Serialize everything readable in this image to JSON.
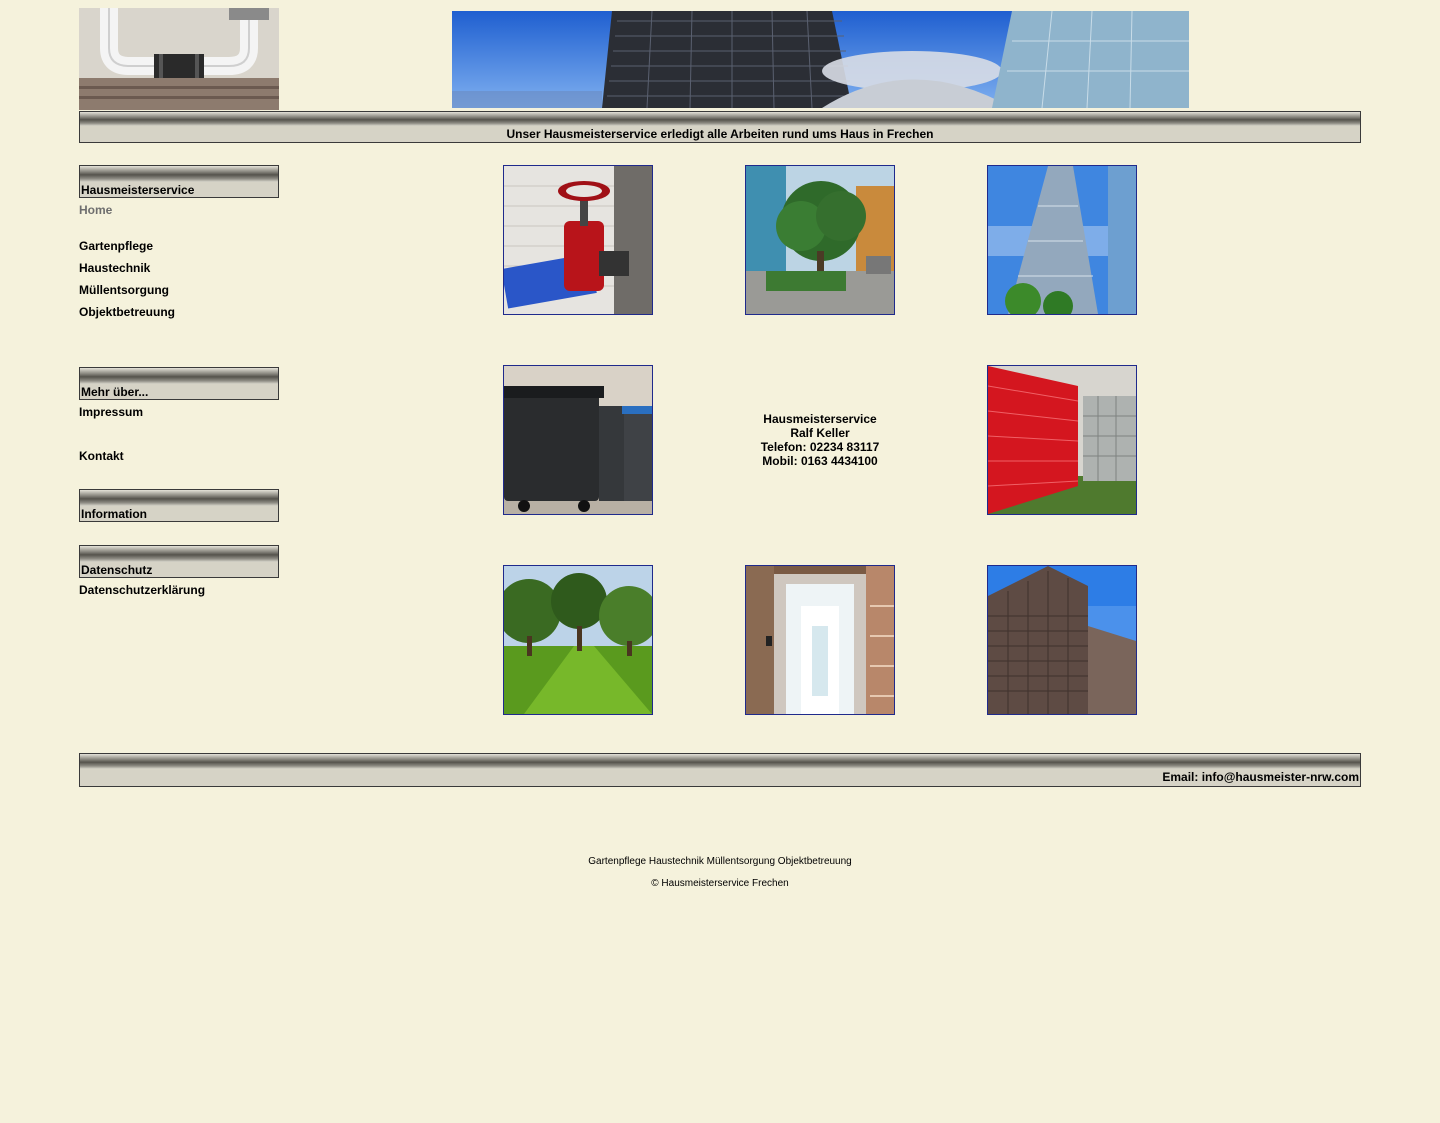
{
  "header": {
    "logo_alt": "pipe-logo",
    "banner_alt": "building-banner",
    "tagline": "Unser Hausmeisterservice erledigt alle Arbeiten rund ums Haus in Frechen"
  },
  "sidebar": {
    "sections": [
      {
        "title": "Hausmeisterservice",
        "items": [
          "Home",
          "Gartenpflege",
          "Haustechnik",
          "Müllentsorgung",
          "Objektbetreuung"
        ]
      },
      {
        "title": "Mehr über...",
        "items": [
          "Impressum",
          "Kontakt"
        ]
      },
      {
        "title": "Information",
        "items": []
      },
      {
        "title": "Datenschutz",
        "items": [
          "Datenschutzerklärung"
        ]
      }
    ]
  },
  "contact": {
    "line1": "Hausmeisterservice",
    "line2": "Ralf Keller",
    "line3": "Telefon: 02234 83117",
    "line4": "Mobil: 0163 4434100"
  },
  "gallery": [
    "valve-photo",
    "tree-photo",
    "glass-tower-photo",
    "bins-photo",
    "red-fence-photo",
    "garden-photo",
    "elevator-photo",
    "highrise-photo"
  ],
  "footer": {
    "email": "Email: info@hausmeister-nrw.com",
    "links": "Gartenpflege Haustechnik Müllentsorgung Objektbetreuung",
    "copyright": "© Hausmeisterservice Frechen"
  },
  "colors": {
    "background": "#f5f2dc",
    "thumb_border": "#1f2a8c",
    "label_bg": "#d6d3c6"
  }
}
